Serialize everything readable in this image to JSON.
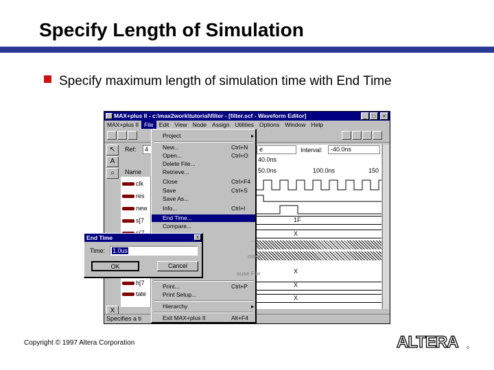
{
  "slide": {
    "title": "Specify Length of Simulation",
    "bullet": "Specify maximum length of simulation time with End Time",
    "copyright": "Copyright © 1997 Altera Corporation",
    "logo_text": "ALTERA",
    "accent_color": "#2b3a97",
    "bullet_color": "#cc1111"
  },
  "window": {
    "title": "MAX+plus II - c:\\max2work\\tutorial\\filter - [filter.scf - Waveform Editor]",
    "menu": [
      "MAX+plus II",
      "File",
      "Edit",
      "View",
      "Node",
      "Assign",
      "Utilities",
      "Options",
      "Window",
      "Help"
    ],
    "ref_label": "Ref:",
    "ref_value": "4",
    "name_header": "Name",
    "signals": [
      "clk",
      "res",
      "new",
      "s[7",
      "s(7",
      "h[7",
      "tate"
    ],
    "wave": {
      "time_value": "e",
      "interval_label": "Interval:",
      "interval_value": "-40.0ns",
      "time_readout": "40.0ns",
      "ticks": [
        "50.0ns",
        "100.0ns",
        "150"
      ],
      "values": [
        "1F",
        "X",
        "X",
        "X",
        "X"
      ]
    },
    "status": "Specifies a ti"
  },
  "file_menu": {
    "items": [
      {
        "label": "Project",
        "arrow": "▸"
      },
      {
        "label": "New...",
        "shortcut": "Ctrl+N"
      },
      {
        "label": "Open...",
        "shortcut": "Ctrl+O"
      },
      {
        "label": "Delete File..."
      },
      {
        "label": "Retrieve..."
      },
      {
        "label": "Close",
        "shortcut": "Ctrl+F4"
      },
      {
        "label": "Save",
        "shortcut": "Ctrl+S"
      },
      {
        "label": "Save As..."
      },
      {
        "label": "Info...",
        "shortcut": "Ctrl+I"
      },
      {
        "label": "End Time...",
        "highlighted": true
      },
      {
        "label": "Compare..."
      },
      {
        "label": "Print...",
        "shortcut": "Ctrl+P"
      },
      {
        "label": "Print Setup..."
      },
      {
        "label": "Hierarchy",
        "arrow": "▸"
      },
      {
        "label": "Exit MAX+plus II",
        "shortcut": "Alt+F4"
      }
    ],
    "partial": [
      "...",
      "...",
      "mbol",
      "ause File"
    ]
  },
  "dialog": {
    "title": "End Time",
    "close": "x",
    "time_label": "Time:",
    "time_value": "1.0us",
    "ok": "OK",
    "cancel": "Cancel"
  }
}
